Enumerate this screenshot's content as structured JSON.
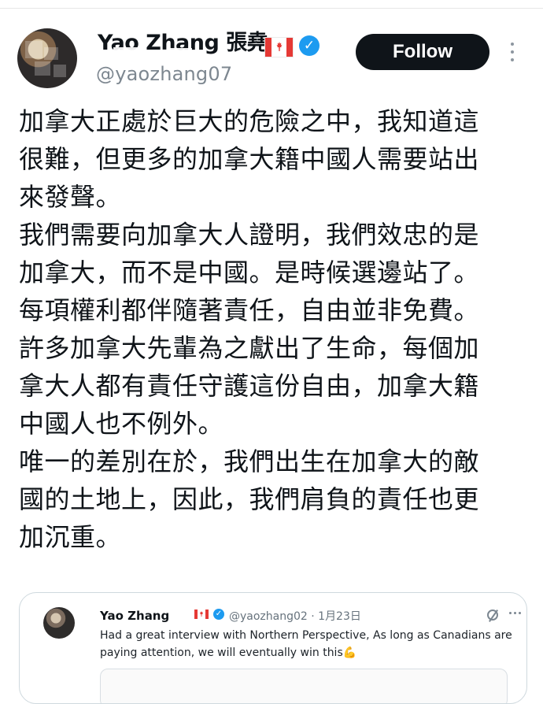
{
  "post": {
    "author": {
      "display_name": "Yao Zhang 張堯",
      "handle": "@yaozhang07"
    },
    "follow_label": "Follow",
    "text_lines": [
      "加拿大正處於巨大的危險之中，我知道這",
      "很難，但更多的加拿大籍中國人需要站出",
      "來發聲。",
      "我們需要向加拿大人證明，我們效忠的是",
      "加拿大，而不是中國。是時候選邊站了。",
      "每項權利都伴隨著責任，自由並非免費。",
      "許多加拿大先輩為之獻出了生命，每個加",
      "拿大人都有責任守護這份自由，加拿大籍",
      "中國人也不例外。",
      "唯一的差別在於，我們出生在加拿大的敵",
      "國的土地上，因此，我們肩負的責任也更",
      "加沉重。"
    ]
  },
  "quote": {
    "author_name": "Yao Zhang",
    "handle_date": "@yaozhang02 · 1月23日",
    "text_lines": [
      "Had a great interview with Northern Perspective, As long as Canadians are",
      "paying attention, we will eventually win this💪"
    ]
  },
  "icons": {
    "verified": "verified-badge",
    "more": "more-icon",
    "grok": "grok-icon",
    "flag": "canada-flag-icon"
  },
  "colors": {
    "follow_button_bg": "#0f1419",
    "verified_blue": "#1d9bf0",
    "muted_text": "#7d8790",
    "flag_red": "#e53935"
  }
}
